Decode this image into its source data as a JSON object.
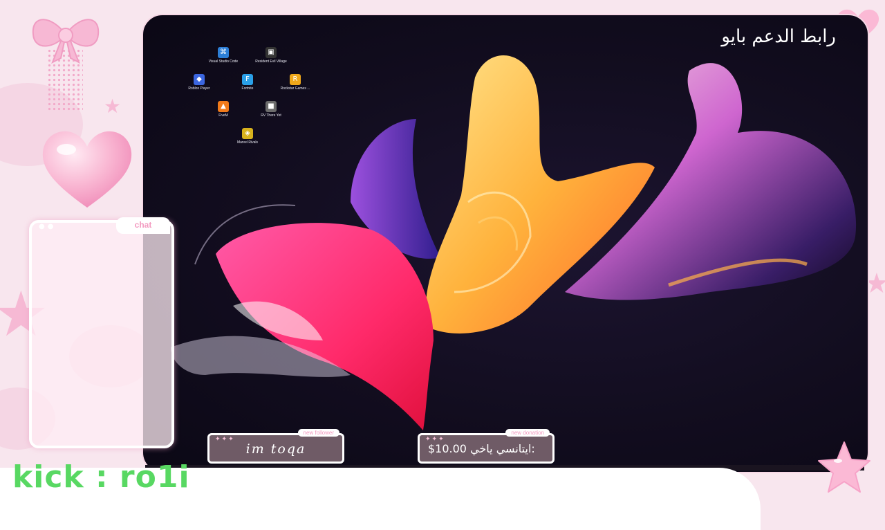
{
  "overlay": {
    "support_link": "رابط الدعم بايو",
    "chat_label": "chat",
    "kick_handle": "kick : ro1i",
    "colors": {
      "pink_accent": "#f39ac0",
      "kick_green": "#58d862",
      "background": "#f8e6ee"
    }
  },
  "desktop": {
    "icons": [
      {
        "label": "Visual Studio Code",
        "icon": "vscode-icon",
        "color": "#2d7fd6"
      },
      {
        "label": "Resident Evil Village",
        "icon": "resident-evil-icon",
        "color": "#333333"
      },
      {
        "label": "Roblox Player",
        "icon": "roblox-icon",
        "color": "#3b66e0"
      },
      {
        "label": "Fortnite",
        "icon": "fortnite-icon",
        "color": "#2aa0e8"
      },
      {
        "label": "Rockstar Games ...",
        "icon": "rockstar-icon",
        "color": "#f0a81a"
      },
      {
        "label": "FiveM",
        "icon": "fivem-icon",
        "color": "#f07a1a"
      },
      {
        "label": "RV There Yet",
        "icon": "rv-there-yet-icon",
        "color": "#6c6c6c"
      },
      {
        "label": "Marvel Rivals",
        "icon": "marvel-rivals-icon",
        "color": "#d8b21d"
      }
    ]
  },
  "alerts": {
    "follower": {
      "tag": "new follower",
      "name": "im toqa"
    },
    "donation": {
      "tag": "new donation",
      "message": "ايتانسي ياخي:",
      "amount": "$10.00"
    }
  }
}
